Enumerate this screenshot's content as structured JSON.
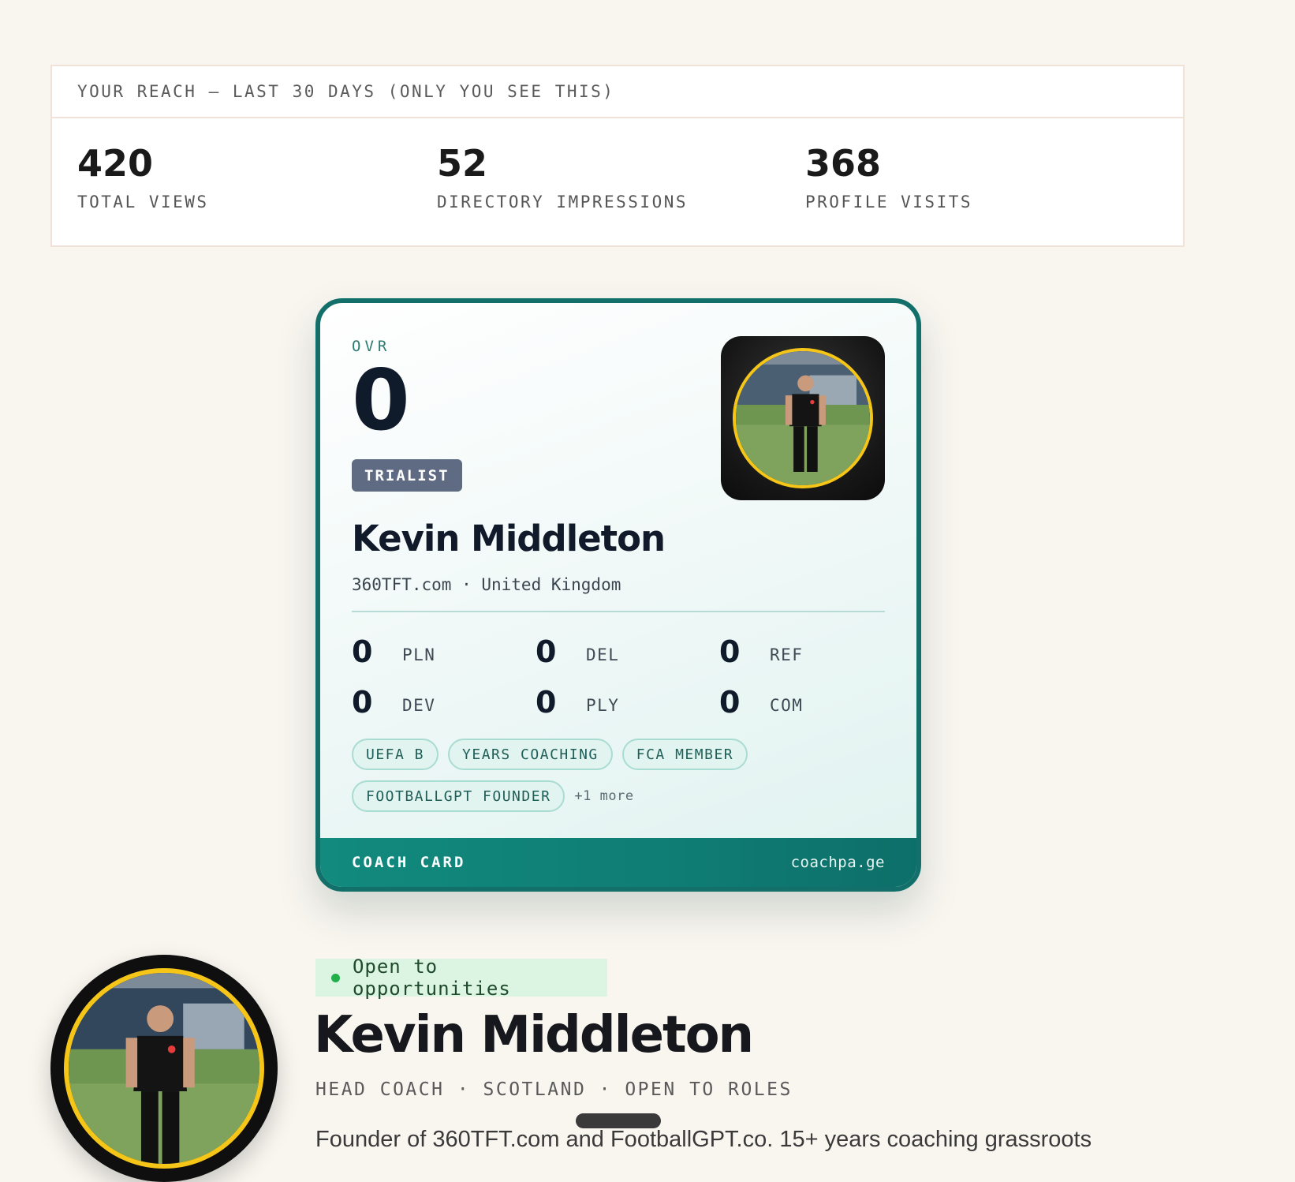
{
  "reach": {
    "title": "YOUR REACH — LAST 30 DAYS (ONLY YOU SEE THIS)",
    "stats": [
      {
        "value": "420",
        "label": "TOTAL VIEWS"
      },
      {
        "value": "52",
        "label": "DIRECTORY IMPRESSIONS"
      },
      {
        "value": "368",
        "label": "PROFILE VISITS"
      }
    ]
  },
  "card": {
    "ovr_label": "OVR",
    "ovr_value": "0",
    "tier_badge": "TRIALIST",
    "name": "Kevin Middleton",
    "subtitle": "360TFT.com · United Kingdom",
    "attributes": [
      {
        "value": "0",
        "label": "PLN"
      },
      {
        "value": "0",
        "label": "DEL"
      },
      {
        "value": "0",
        "label": "REF"
      },
      {
        "value": "0",
        "label": "DEV"
      },
      {
        "value": "0",
        "label": "PLY"
      },
      {
        "value": "0",
        "label": "COM"
      }
    ],
    "tags": [
      "UEFA B",
      "YEARS COACHING",
      "FCA MEMBER",
      "FOOTBALLGPT FOUNDER"
    ],
    "more_tags": "+1 more",
    "footer_title": "COACH CARD",
    "footer_domain": "coachpa.ge",
    "accent_color": "#136f6a",
    "ring_color": "#f5c518"
  },
  "profile": {
    "status": "Open to opportunities",
    "status_color": "#22b04a",
    "name": "Kevin Middleton",
    "meta": "HEAD COACH · SCOTLAND · OPEN TO ROLES",
    "bio": "Founder of 360TFT.com and FootballGPT.co. 15+ years coaching grassroots"
  },
  "colors": {
    "background": "#f9f6f0",
    "card_teal": "#128a7e"
  }
}
